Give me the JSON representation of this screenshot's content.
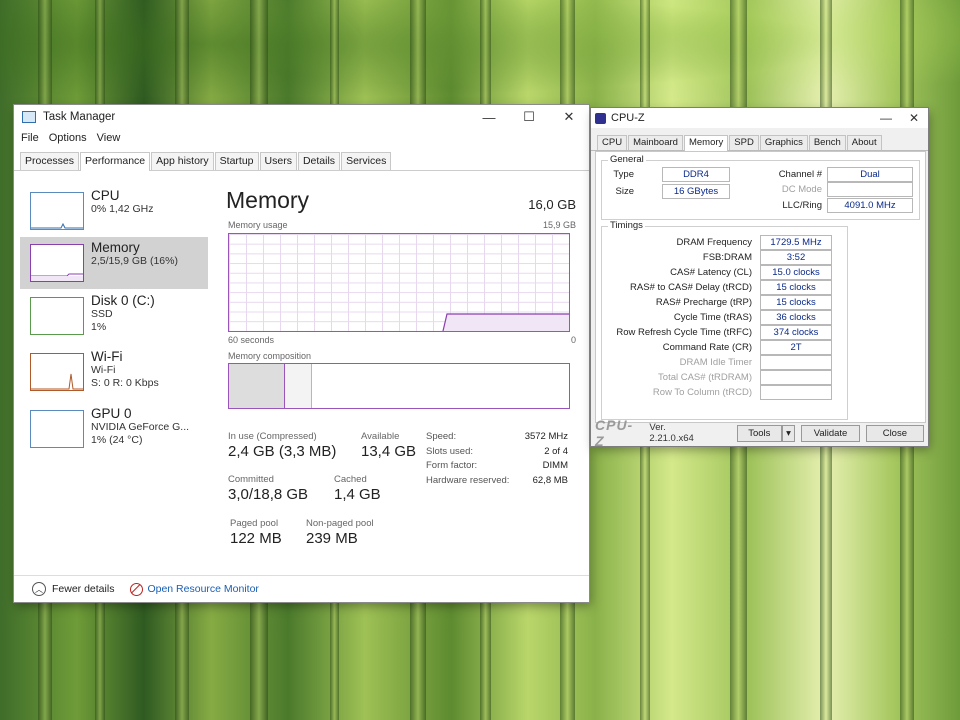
{
  "task_manager": {
    "title": "Task Manager",
    "window_buttons": [
      "—",
      "☐",
      "✕"
    ],
    "menu": [
      "File",
      "Options",
      "View"
    ],
    "tabs": [
      "Processes",
      "Performance",
      "App history",
      "Startup",
      "Users",
      "Details",
      "Services"
    ],
    "active_tab": "Performance",
    "sidebar": [
      {
        "name": "CPU",
        "line1": "0% 1,42 GHz",
        "line2": ""
      },
      {
        "name": "Memory",
        "line1": "2,5/15,9 GB (16%)",
        "line2": ""
      },
      {
        "name": "Disk 0 (C:)",
        "line1": "SSD",
        "line2": "1%"
      },
      {
        "name": "Wi-Fi",
        "line1": "Wi-Fi",
        "line2": "S: 0 R: 0 Kbps"
      },
      {
        "name": "GPU 0",
        "line1": "NVIDIA GeForce G...",
        "line2": "1% (24 °C)"
      }
    ],
    "selected_sidebar": "Memory",
    "main": {
      "title": "Memory",
      "total": "16,0 GB",
      "usage_label": "Memory usage",
      "usage_max": "15,9 GB",
      "seconds_label": "60 seconds",
      "zero_label": "0",
      "composition_label": "Memory composition",
      "in_use": {
        "label": "In use (Compressed)",
        "value": "2,4 GB (3,3 MB)"
      },
      "available": {
        "label": "Available",
        "value": "13,4 GB"
      },
      "committed": {
        "label": "Committed",
        "value": "3,0/18,8 GB"
      },
      "cached": {
        "label": "Cached",
        "value": "1,4 GB"
      },
      "paged_pool": {
        "label": "Paged pool",
        "value": "122 MB"
      },
      "nonpaged_pool": {
        "label": "Non-paged pool",
        "value": "239 MB"
      },
      "details": [
        {
          "label": "Speed:",
          "value": "3572 MHz"
        },
        {
          "label": "Slots used:",
          "value": "2 of 4"
        },
        {
          "label": "Form factor:",
          "value": "DIMM"
        },
        {
          "label": "Hardware reserved:",
          "value": "62,8 MB"
        }
      ]
    },
    "footer": {
      "fewer_details": "Fewer details",
      "open_monitor": "Open Resource Monitor"
    },
    "colors": {
      "memory_accent": "#9955bb",
      "link": "#1a5fb4"
    }
  },
  "cpuz": {
    "title": "CPU-Z",
    "window_buttons": [
      "—",
      "✕"
    ],
    "tabs": [
      "CPU",
      "Mainboard",
      "Memory",
      "SPD",
      "Graphics",
      "Bench",
      "About"
    ],
    "active_tab": "Memory",
    "general": {
      "title": "General",
      "type_label": "Type",
      "type": "DDR4",
      "size_label": "Size",
      "size": "16 GBytes",
      "channel_label": "Channel #",
      "channel": "Dual",
      "dc_mode_label": "DC Mode",
      "dc_mode": "",
      "uncore_label": "LLC/Ring",
      "uncore": "4091.0 MHz"
    },
    "timings": {
      "title": "Timings",
      "rows": [
        {
          "label": "DRAM Frequency",
          "value": "1729.5 MHz"
        },
        {
          "label": "FSB:DRAM",
          "value": "3:52"
        },
        {
          "label": "CAS# Latency (CL)",
          "value": "15.0 clocks"
        },
        {
          "label": "RAS# to CAS# Delay (tRCD)",
          "value": "15 clocks"
        },
        {
          "label": "RAS# Precharge (tRP)",
          "value": "15 clocks"
        },
        {
          "label": "Cycle Time (tRAS)",
          "value": "36 clocks"
        },
        {
          "label": "Row Refresh Cycle Time (tRFC)",
          "value": "374 clocks"
        },
        {
          "label": "Command Rate (CR)",
          "value": "2T"
        },
        {
          "label": "DRAM Idle Timer",
          "value": ""
        },
        {
          "label": "Total CAS# (tRDRAM)",
          "value": ""
        },
        {
          "label": "Row To Column (tRCD)",
          "value": ""
        }
      ]
    },
    "footer": {
      "logo": "CPU-Z",
      "version": "Ver. 2.21.0.x64",
      "tools": "Tools",
      "validate": "Validate",
      "close": "Close"
    }
  }
}
